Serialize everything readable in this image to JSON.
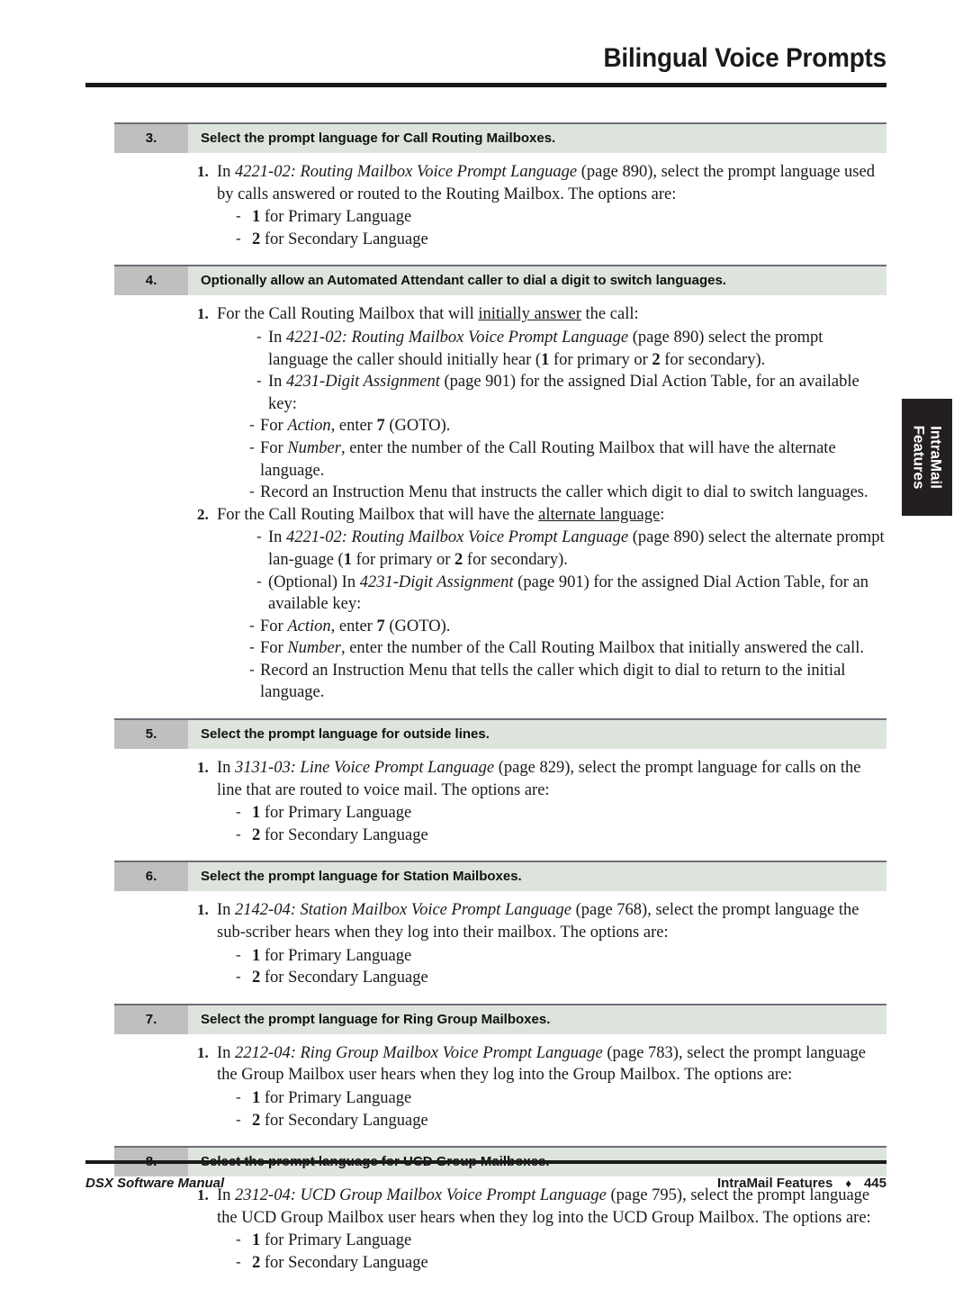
{
  "header": {
    "title": "Bilingual Voice Prompts"
  },
  "side_tab": {
    "line1": "IntraMail",
    "line2": "Features"
  },
  "footer": {
    "left": "DSX Software Manual",
    "section": "IntraMail Features",
    "separator": "♦",
    "page_number": "445"
  },
  "steps": [
    {
      "number": "3.",
      "title": "Select the prompt language for Call Routing Mailboxes.",
      "items": [
        {
          "marker": "1.",
          "text_html": "In <i>4221-02: Routing Mailbox Voice Prompt Language</i> (page 890), select the prompt language used by calls answered or routed to the Routing Mailbox. The options are:"
        }
      ],
      "options": [
        {
          "marker": "-",
          "text_html": "<b>1</b> for Primary Language"
        },
        {
          "marker": "-",
          "text_html": "<b>2</b> for Secondary Language"
        }
      ]
    },
    {
      "number": "4.",
      "title": "Optionally allow an Automated Attendant caller to dial a digit to switch languages.",
      "blocks": [
        {
          "marker": "1.",
          "text_html": "For the Call Routing Mailbox that will <span class=\"ul\">initially answer</span> the call:",
          "children": [
            {
              "marker": "-",
              "text_html": "In <i>4221-02: Routing Mailbox Voice Prompt Language</i> (page 890) select the prompt language the caller should initially hear (<b>1</b> for primary or <b>2</b> for secondary)."
            },
            {
              "marker": "-",
              "text_html": "In <i>4231-Digit Assignment</i> (page 901) for the assigned Dial Action Table, for an available key:",
              "children": [
                {
                  "marker": "-",
                  "text_html": "For <i>Action</i>, enter <b>7</b> (GOTO)."
                },
                {
                  "marker": "-",
                  "text_html": "For <i>Number</i>, enter the number of the Call Routing Mailbox that will have the alternate language."
                },
                {
                  "marker": "-",
                  "text_html": "Record an Instruction Menu that instructs the caller which digit to dial to switch languages."
                }
              ]
            }
          ]
        },
        {
          "marker": "2.",
          "text_html": "For the Call Routing Mailbox that will have the <span class=\"ul\">alternate language</span>:",
          "children": [
            {
              "marker": "-",
              "text_html": "In <i>4221-02: Routing Mailbox Voice Prompt Language</i> (page 890) select the alternate prompt lan&#8208;guage (<b>1</b> for primary or <b>2</b> for secondary)."
            },
            {
              "marker": "-",
              "text_html": "(Optional) In <i>4231-Digit Assignment</i> (page 901) for the assigned Dial Action Table, for an available key:",
              "children": [
                {
                  "marker": "-",
                  "text_html": "For <i>Action</i>, enter <b>7</b> (GOTO)."
                },
                {
                  "marker": "-",
                  "text_html": "For <i>Number</i>, enter the number of the Call Routing Mailbox that initially answered the call."
                },
                {
                  "marker": "-",
                  "text_html": "Record an Instruction Menu that tells the caller which digit to dial to return to the initial language."
                }
              ]
            }
          ]
        }
      ]
    },
    {
      "number": "5.",
      "title": "Select the prompt language for outside lines.",
      "items": [
        {
          "marker": "1.",
          "text_html": "In <i>3131-03: Line Voice Prompt Language</i> (page 829), select the prompt language for calls on the line that are routed to voice mail. The options are:"
        }
      ],
      "options": [
        {
          "marker": "-",
          "text_html": "<b>1</b> for Primary Language"
        },
        {
          "marker": "-",
          "text_html": "<b>2</b> for Secondary Language"
        }
      ]
    },
    {
      "number": "6.",
      "title": "Select the prompt language for Station Mailboxes.",
      "items": [
        {
          "marker": "1.",
          "text_html": "In <i>2142-04: Station Mailbox Voice Prompt Language</i> (page 768), select the prompt language the sub&#8208;scriber hears when they log into their mailbox. The options are:"
        }
      ],
      "options": [
        {
          "marker": "-",
          "text_html": "<b>1</b> for Primary Language"
        },
        {
          "marker": "-",
          "text_html": "<b>2</b> for Secondary Language"
        }
      ]
    },
    {
      "number": "7.",
      "title": "Select the prompt language for Ring Group Mailboxes.",
      "items": [
        {
          "marker": "1.",
          "text_html": "In <i>2212-04: Ring Group Mailbox Voice Prompt Language</i> (page 783), select the prompt language the Group Mailbox user hears when they log into the Group Mailbox. The options are:"
        }
      ],
      "options": [
        {
          "marker": "-",
          "text_html": "<b>1</b> for Primary Language"
        },
        {
          "marker": "-",
          "text_html": "<b>2</b> for Secondary Language"
        }
      ]
    },
    {
      "number": "8.",
      "title": "Select the prompt language for UCD Group Mailboxes.",
      "items": [
        {
          "marker": "1.",
          "text_html": "In <i>2312-04: UCD Group Mailbox Voice Prompt Language</i> (page 795), select the prompt language the UCD Group Mailbox user hears when they log into the UCD Group Mailbox. The options are:"
        }
      ],
      "options": [
        {
          "marker": "-",
          "text_html": "<b>1</b> for Primary Language"
        },
        {
          "marker": "-",
          "text_html": "<b>2</b> for Secondary Language"
        }
      ]
    }
  ]
}
